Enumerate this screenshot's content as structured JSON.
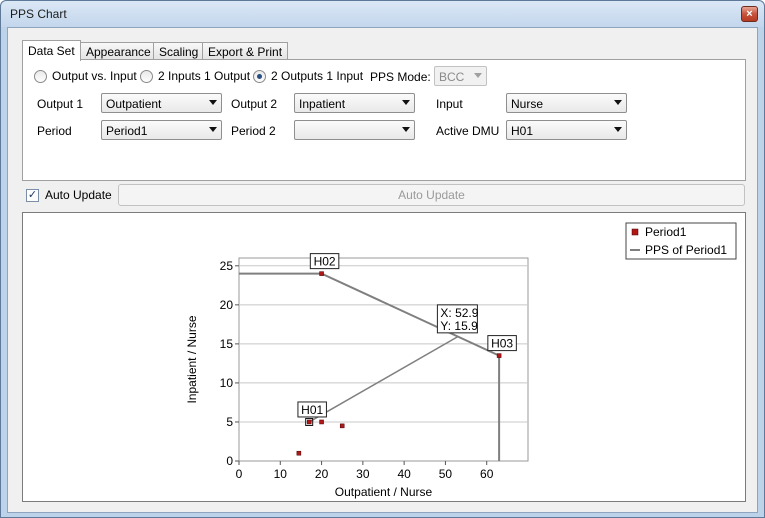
{
  "window": {
    "title": "PPS Chart",
    "close_glyph": "×"
  },
  "tabs": [
    {
      "label": "Data Set",
      "active": true
    },
    {
      "label": "Appearance",
      "active": false
    },
    {
      "label": "Scaling",
      "active": false
    },
    {
      "label": "Export & Print",
      "active": false
    }
  ],
  "mode_radios": [
    {
      "label": "Output vs. Input",
      "checked": false
    },
    {
      "label": "2 Inputs 1 Output",
      "checked": false
    },
    {
      "label": "2 Outputs 1 Input",
      "checked": true
    }
  ],
  "pps_mode": {
    "label": "PPS Mode:",
    "value": "BCC",
    "disabled": true
  },
  "fields": {
    "output1": {
      "label": "Output 1",
      "value": "Outpatient"
    },
    "output2": {
      "label": "Output 2",
      "value": "Inpatient"
    },
    "input": {
      "label": "Input",
      "value": "Nurse"
    },
    "period": {
      "label": "Period",
      "value": "Period1"
    },
    "period2": {
      "label": "Period 2",
      "value": ""
    },
    "active_dmu": {
      "label": "Active DMU",
      "value": "H01"
    }
  },
  "auto_update": {
    "checkbox_label": "Auto Update",
    "checked": true,
    "button_label": "Auto Update"
  },
  "colors": {
    "point": "#b01818",
    "frontier": "#7f7f7f",
    "grid": "#c8c8c8"
  },
  "chart_data": {
    "type": "scatter",
    "xlabel": "Outpatient / Nurse",
    "ylabel": "Inpatient / Nurse",
    "xlim": [
      0,
      70
    ],
    "ylim": [
      0,
      26
    ],
    "xticks": [
      0,
      10,
      20,
      30,
      40,
      50,
      60
    ],
    "yticks": [
      0,
      5,
      10,
      15,
      20,
      25
    ],
    "grid": "horizontal",
    "legend_position": "top-right",
    "legend": [
      {
        "label": "Period1",
        "kind": "marker"
      },
      {
        "label": "PPS of Period1",
        "kind": "line"
      }
    ],
    "series": [
      {
        "name": "Period1",
        "points": [
          {
            "x": 20,
            "y": 24,
            "label": "H02"
          },
          {
            "x": 63,
            "y": 13.5,
            "label": "H03"
          },
          {
            "x": 17,
            "y": 5,
            "label": "H01"
          },
          {
            "x": 20,
            "y": 5
          },
          {
            "x": 25,
            "y": 4.5
          },
          {
            "x": 14.5,
            "y": 1
          }
        ]
      },
      {
        "name": "PPS of Period1",
        "frontier": [
          [
            0,
            24
          ],
          [
            20,
            24
          ],
          [
            63,
            13.5
          ],
          [
            63,
            0
          ]
        ]
      }
    ],
    "projection": {
      "from": [
        17,
        5
      ],
      "to": [
        52.9,
        15.9
      ]
    },
    "annotation": {
      "x_text": "X: 52.9",
      "y_text": "Y: 15.9"
    }
  }
}
